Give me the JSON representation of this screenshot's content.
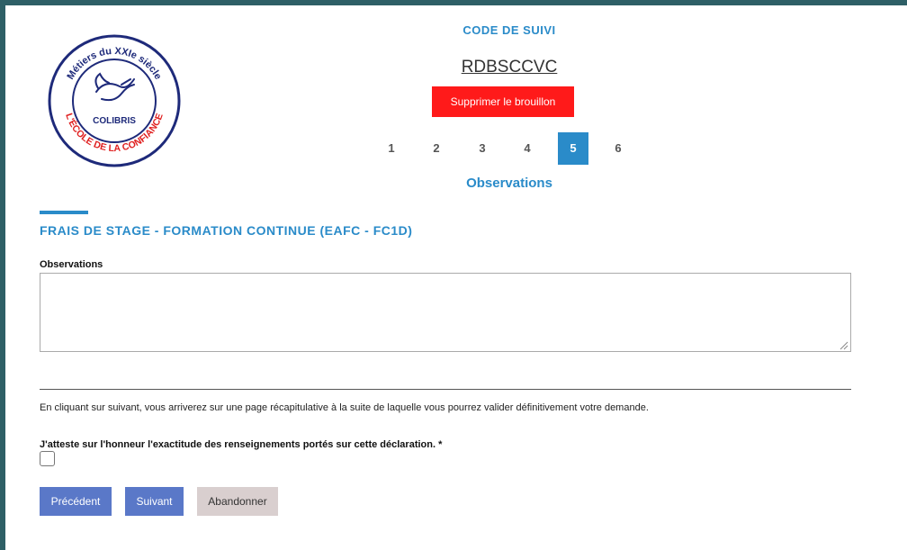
{
  "header": {
    "tracking_label": "CODE DE SUIVI",
    "tracking_code": "RDBSCCVC",
    "delete_draft_label": "Supprimer le brouillon"
  },
  "logo": {
    "top_text": "Métiers du XXIe siècle",
    "center_text": "COLIBRIS",
    "bottom_text": "L'ÉCOLE DE LA CONFIANCE",
    "icon": "hummingbird-icon"
  },
  "steps": {
    "items": [
      "1",
      "2",
      "3",
      "4",
      "5",
      "6"
    ],
    "active": "5",
    "current_title": "Observations"
  },
  "form": {
    "section_title": "FRAIS DE STAGE - FORMATION CONTINUE (EAFC - FC1D)",
    "observations_label": "Observations",
    "observations_value": "",
    "info_text": "En cliquant sur suivant, vous arriverez sur une page récapitulative à la suite de laquelle vous pourrez valider définitivement votre demande.",
    "attest_label": "J'atteste sur l'honneur l'exactitude des renseignements portés sur cette déclaration. *",
    "attest_checked": false
  },
  "buttons": {
    "previous": "Précédent",
    "next": "Suivant",
    "abandon": "Abandonner"
  },
  "colors": {
    "accent": "#2a8bc9",
    "danger": "#ff1a1a",
    "button_blue": "#5a78c8",
    "button_grey": "#d9cfcf",
    "frame": "#2e5f66"
  }
}
